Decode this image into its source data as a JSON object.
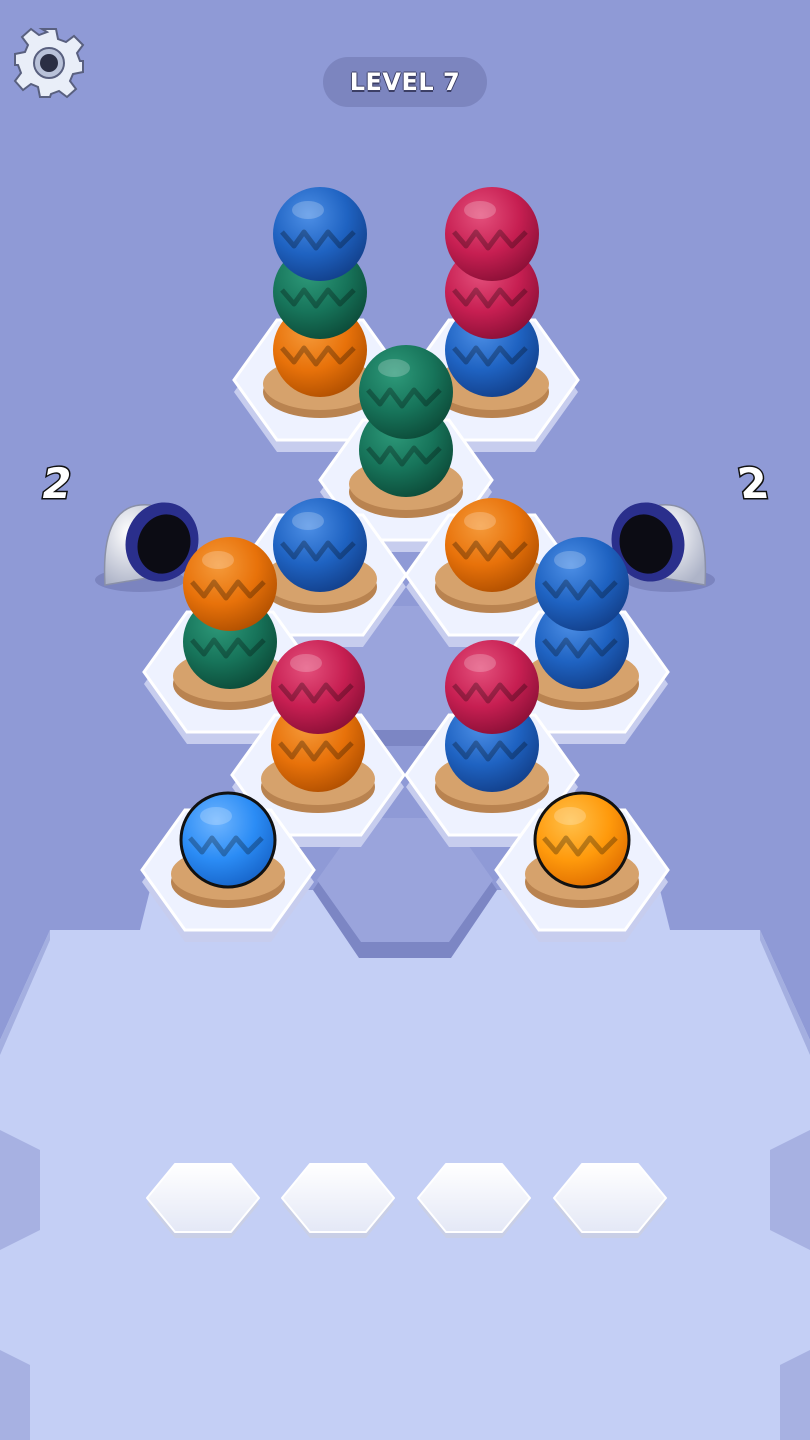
{
  "hud": {
    "level_label": "LEVEL 7",
    "settings_icon": "gear-icon"
  },
  "colors": {
    "blue": "#1f63c2",
    "green": "#17745a",
    "orange": "#e8720a",
    "red": "#c71f52",
    "bright_blue": "#2b8cf5",
    "bright_orange": "#ff9a0c",
    "background": "#8f9ad6",
    "tile": "#eef2ff",
    "base": "#d6a26c"
  },
  "launchers": [
    {
      "side": "left",
      "count": "2"
    },
    {
      "side": "right",
      "count": "2"
    }
  ],
  "stacks": [
    {
      "id": "top-left",
      "balls": [
        "orange",
        "green",
        "blue"
      ]
    },
    {
      "id": "top-right",
      "balls": [
        "blue",
        "red",
        "red"
      ]
    },
    {
      "id": "center-top",
      "balls": [
        "green",
        "green"
      ]
    },
    {
      "id": "mid-left",
      "balls": [
        "blue"
      ]
    },
    {
      "id": "mid-right",
      "balls": [
        "orange"
      ]
    },
    {
      "id": "far-left",
      "balls": [
        "green",
        "orange"
      ]
    },
    {
      "id": "far-right",
      "balls": [
        "blue",
        "blue"
      ]
    },
    {
      "id": "lower-left",
      "balls": [
        "orange",
        "red"
      ]
    },
    {
      "id": "lower-right",
      "balls": [
        "blue",
        "red"
      ]
    },
    {
      "id": "bottom-left",
      "balls": [
        "bright_blue"
      ],
      "selected": true
    },
    {
      "id": "bottom-right",
      "balls": [
        "bright_orange"
      ],
      "selected": true
    }
  ],
  "holding_slots": {
    "count": 4,
    "filled": 0
  }
}
